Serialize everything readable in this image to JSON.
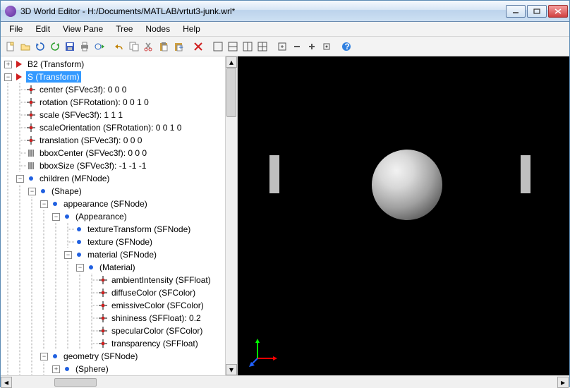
{
  "window": {
    "title": "3D World Editor - H:/Documents/MATLAB/vrtut3-junk.wrl*"
  },
  "menu": {
    "items": [
      "File",
      "Edit",
      "View Pane",
      "Tree",
      "Nodes",
      "Help"
    ]
  },
  "toolbar": {
    "names": [
      "new-file",
      "open-file",
      "refresh",
      "reload-green",
      "save",
      "print",
      "world-step",
      "sep",
      "undo",
      "copy",
      "cut",
      "paste",
      "paste-special",
      "sep",
      "delete",
      "sep",
      "layout-1",
      "layout-2h",
      "layout-2v",
      "layout-4",
      "sep",
      "fit",
      "zoom-out",
      "zoom-in",
      "zoom-reset",
      "sep",
      "help"
    ]
  },
  "tree": {
    "rows": [
      {
        "depth": 0,
        "toggle": "plus",
        "icon": "tri-red",
        "text": "B2 (Transform)",
        "sel": false
      },
      {
        "depth": 0,
        "toggle": "minus",
        "icon": "tri-red",
        "text": "S (Transform)",
        "sel": true
      },
      {
        "depth": 1,
        "toggle": "",
        "icon": "crosshair",
        "text": "center (SFVec3f): 0  0  0"
      },
      {
        "depth": 1,
        "toggle": "",
        "icon": "crosshair",
        "text": "rotation (SFRotation): 0  0  1  0"
      },
      {
        "depth": 1,
        "toggle": "",
        "icon": "crosshair",
        "text": "scale (SFVec3f): 1  1  1"
      },
      {
        "depth": 1,
        "toggle": "",
        "icon": "crosshair",
        "text": "scaleOrientation (SFRotation): 0  0  1  0"
      },
      {
        "depth": 1,
        "toggle": "",
        "icon": "crosshair",
        "text": "translation (SFVec3f): 0  0  0"
      },
      {
        "depth": 1,
        "toggle": "",
        "icon": "bars",
        "text": "bboxCenter (SFVec3f): 0  0  0"
      },
      {
        "depth": 1,
        "toggle": "",
        "icon": "bars",
        "text": "bboxSize (SFVec3f): -1  -1  -1"
      },
      {
        "depth": 1,
        "toggle": "minus",
        "icon": "bluedot",
        "text": "children (MFNode)"
      },
      {
        "depth": 2,
        "toggle": "minus",
        "icon": "bluedot",
        "text": "(Shape)"
      },
      {
        "depth": 3,
        "toggle": "minus",
        "icon": "bluedot",
        "text": "appearance (SFNode)"
      },
      {
        "depth": 4,
        "toggle": "minus",
        "icon": "bluedot",
        "text": "(Appearance)"
      },
      {
        "depth": 5,
        "toggle": "",
        "icon": "bluedot",
        "text": "textureTransform (SFNode)"
      },
      {
        "depth": 5,
        "toggle": "",
        "icon": "bluedot",
        "text": "texture (SFNode)"
      },
      {
        "depth": 5,
        "toggle": "minus",
        "icon": "bluedot",
        "text": "material (SFNode)"
      },
      {
        "depth": 6,
        "toggle": "minus",
        "icon": "bluedot",
        "text": "(Material)"
      },
      {
        "depth": 7,
        "toggle": "",
        "icon": "crosshair",
        "text": "ambientIntensity (SFFloat)"
      },
      {
        "depth": 7,
        "toggle": "",
        "icon": "crosshair",
        "text": "diffuseColor (SFColor)"
      },
      {
        "depth": 7,
        "toggle": "",
        "icon": "crosshair",
        "text": "emissiveColor (SFColor)"
      },
      {
        "depth": 7,
        "toggle": "",
        "icon": "crosshair",
        "text": "shininess (SFFloat): 0.2"
      },
      {
        "depth": 7,
        "toggle": "",
        "icon": "crosshair",
        "text": "specularColor (SFColor)"
      },
      {
        "depth": 7,
        "toggle": "",
        "icon": "crosshair",
        "text": "transparency (SFFloat)"
      },
      {
        "depth": 3,
        "toggle": "minus",
        "icon": "bluedot",
        "text": "geometry (SFNode)"
      },
      {
        "depth": 4,
        "toggle": "plus",
        "icon": "bluedot",
        "text": "(Sphere)"
      }
    ]
  }
}
